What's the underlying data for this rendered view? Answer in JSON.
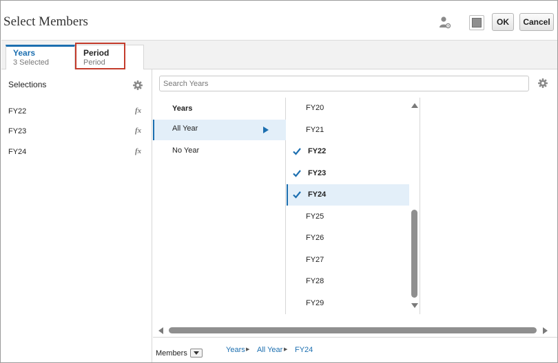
{
  "dialog": {
    "title": "Select Members",
    "ok_label": "OK",
    "cancel_label": "Cancel"
  },
  "tabs": [
    {
      "title": "Years",
      "subtitle": "3 Selected",
      "active": true
    },
    {
      "title": "Period",
      "subtitle": "Period",
      "active": false,
      "highlighted": true
    }
  ],
  "selections": {
    "label": "Selections",
    "items": [
      "FY22",
      "FY23",
      "FY24"
    ],
    "function_icon": "fx"
  },
  "search": {
    "placeholder": "Search Years",
    "value": ""
  },
  "hierarchy": {
    "header": "Years",
    "items": [
      {
        "label": "All Year",
        "active": true
      },
      {
        "label": "No Year",
        "active": false
      }
    ]
  },
  "members": [
    {
      "label": "FY20",
      "checked": false,
      "active": false
    },
    {
      "label": "FY21",
      "checked": false,
      "active": false
    },
    {
      "label": "FY22",
      "checked": true,
      "active": false
    },
    {
      "label": "FY23",
      "checked": true,
      "active": false
    },
    {
      "label": "FY24",
      "checked": true,
      "active": true
    },
    {
      "label": "FY25",
      "checked": false,
      "active": false
    },
    {
      "label": "FY26",
      "checked": false,
      "active": false
    },
    {
      "label": "FY27",
      "checked": false,
      "active": false
    },
    {
      "label": "FY28",
      "checked": false,
      "active": false
    },
    {
      "label": "FY29",
      "checked": false,
      "active": false
    }
  ],
  "footer": {
    "members_label": "Members",
    "breadcrumb": [
      "Years",
      "All Year",
      "FY24"
    ]
  },
  "colors": {
    "accent": "#1c6fb0",
    "selected_row": "#e3eff9",
    "highlight_outline": "#c33a2a"
  }
}
